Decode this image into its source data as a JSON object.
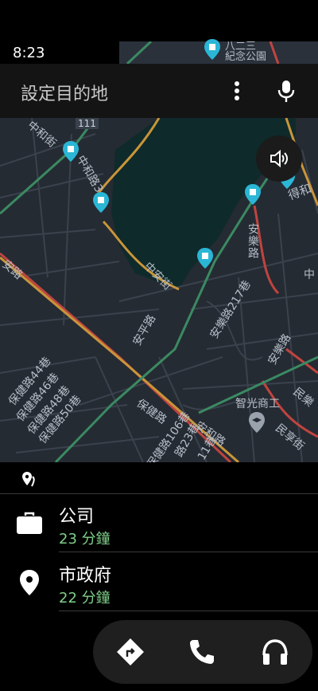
{
  "status_bar": {
    "time": "8:23"
  },
  "search": {
    "placeholder": "設定目的地",
    "more_icon": "more-vert-icon",
    "mic_icon": "mic-icon"
  },
  "map": {
    "volume_icon": "volume-icon",
    "labels": {
      "top_park": "八二三紀念公園",
      "top_park_line1": "八二三",
      "top_park_line2": "紀念公園",
      "route_badge": "111",
      "zhonghe_st": "中和街",
      "zhonghe_rd": "中和路3",
      "dehe": "得和",
      "anle_rd_right": "安樂路",
      "zhong_right": "中",
      "an_left": "安路",
      "zhongan_st": "中安街",
      "anle_217": "安樂路217巷",
      "anping_rd": "安平路",
      "anle_rd_lower": "安樂路",
      "baojian_44": "保健路44巷",
      "baojian_46": "保健路46巷",
      "baojian_48": "保健路48巷",
      "baojian_50": "保健路50巷",
      "zhiguang": "智光商工",
      "minle": "民樂",
      "minxiang": "民享街",
      "baojian_rd": "保健路",
      "anhe": "安和路",
      "baojian_106": "保健路106巷",
      "lane_23": "路23巷",
      "lane_11": "11巷"
    }
  },
  "destinations": [
    {
      "title": "公司",
      "eta": "23 分鐘",
      "icon": "briefcase-icon"
    },
    {
      "title": "市政府",
      "eta": "22 分鐘",
      "icon": "place-pin-icon"
    }
  ],
  "bottom_nav": [
    {
      "name": "navigation",
      "icon": "directions-icon"
    },
    {
      "name": "phone",
      "icon": "phone-icon"
    },
    {
      "name": "audio",
      "icon": "headphones-icon"
    }
  ],
  "colors": {
    "accent_eta": "#7fd08a",
    "pin": "#2bb6d6",
    "map_bg": "#252b33",
    "lake": "#0f2a2a"
  }
}
